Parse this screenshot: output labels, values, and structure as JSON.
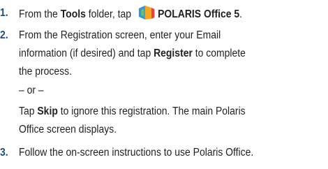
{
  "steps": [
    {
      "number": "1.",
      "pre": "From the ",
      "b1": "Tools",
      "mid": " folder, tap ",
      "b2": "POLARIS Office 5",
      "post": ".",
      "icon": "polaris-office-app-icon"
    },
    {
      "number": "2.",
      "line1": "From the Registration screen, enter your Email",
      "line2_pre": "information (if desired) and tap ",
      "line2_bold": "Register",
      "line2_post": " to complete",
      "line3": "the process.",
      "or": "– or –",
      "line5_pre": "Tap ",
      "line5_bold": "Skip",
      "line5_post": " to ignore this registration. The main Polaris",
      "line6": "Office screen displays."
    },
    {
      "number": "3.",
      "text": "Follow the on-screen instructions to use Polaris Office."
    }
  ],
  "colors": {
    "step_number": "#1f4e79",
    "text": "#231f20"
  }
}
